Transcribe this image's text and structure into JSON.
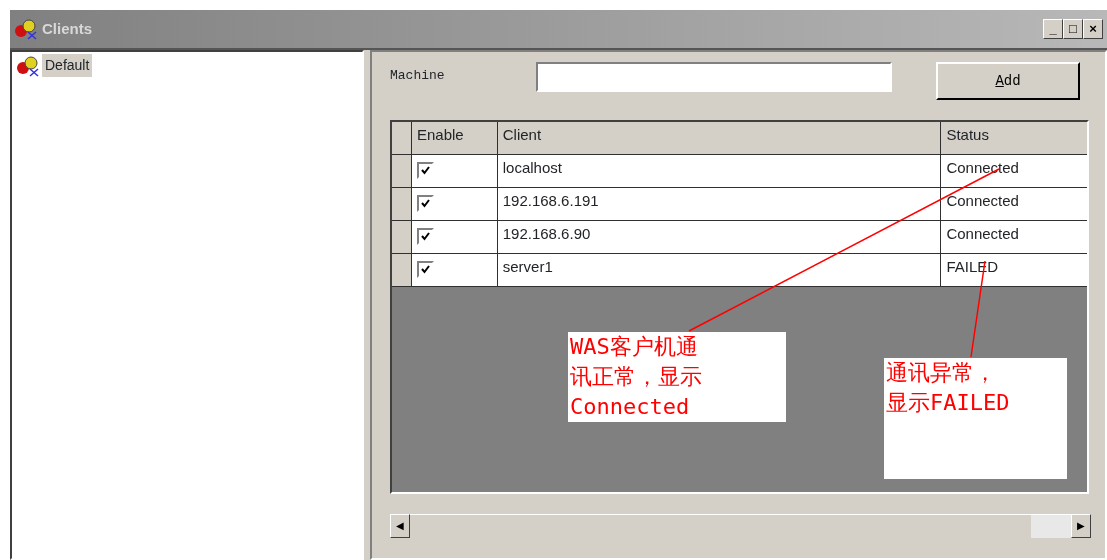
{
  "window": {
    "title": "Clients",
    "controls": [
      "_",
      "□",
      "×"
    ]
  },
  "tree": {
    "items": [
      {
        "label": "Default",
        "selected": true
      }
    ]
  },
  "machine": {
    "label": "Machine"
  },
  "add_button": "Add",
  "table": {
    "columns": [
      "Enable",
      "Client",
      "Status"
    ],
    "rows": [
      {
        "enabled": true,
        "client": "localhost",
        "status": "Connected"
      },
      {
        "enabled": true,
        "client": "192.168.6.191",
        "status": "Connected"
      },
      {
        "enabled": true,
        "client": "192.168.6.90",
        "status": "Connected"
      },
      {
        "enabled": true,
        "client": "server1",
        "status": "FAILED"
      }
    ]
  },
  "annotations": [
    {
      "text": "WAS客户机通讯正常，显示Connected"
    },
    {
      "text": "通讯异常，显示FAILED"
    }
  ],
  "scrollbar": {
    "left": "◀",
    "right": "▶"
  }
}
